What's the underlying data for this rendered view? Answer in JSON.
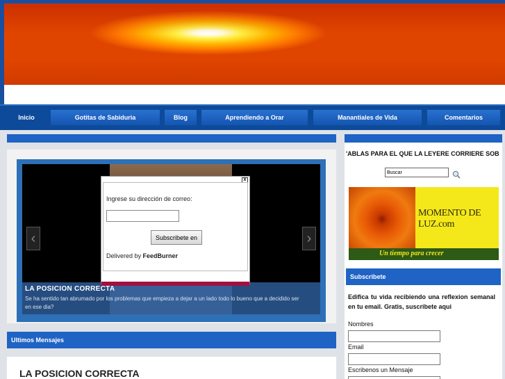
{
  "nav": {
    "items": [
      {
        "label": "Inicio"
      },
      {
        "label": "Gotitas de Sabiduria"
      },
      {
        "label": "Blog"
      },
      {
        "label": "Aprendiendo a Orar"
      },
      {
        "label": "Manantiales de Vida"
      },
      {
        "label": "Comentarios"
      }
    ]
  },
  "slider": {
    "title": "LA POSICION CORRECTA",
    "text": "Se ha sentido tan abrumado por los problemas que empieza a dejar a un lado todo lo bueno que a decidido ser en ese dia?",
    "prev_icon": "chevron-left-icon",
    "next_icon": "chevron-right-icon"
  },
  "popup": {
    "close": "x",
    "label": "Ingrese su dirección de correo:",
    "submit": "Subscribete en",
    "delivered_prefix": "Delivered by",
    "delivered_brand": "FeedBurner"
  },
  "main": {
    "ultimos": "Ultimos Mensajes",
    "post_title": "LA POSICION CORRECTA"
  },
  "sidebar": {
    "marquee": "'ABLAS PARA EL QUE LA LEYERE CORRIERE SOB",
    "search_value": "Buscar",
    "search_icon": "magnifier-icon",
    "ad": {
      "brand": "MOMENTO DE LUZ.com",
      "tagline": "Un tiempo para crecer"
    },
    "subscribe_title": "Subscribete",
    "subscribe_desc": "Edifica tu vida recibiendo una reflexion semanal en tu email. Gratis, suscribete aqui",
    "form": {
      "name_label": "Nombres",
      "email_label": "Email",
      "message_label": "Escribenos un Mensaje"
    }
  },
  "colors": {
    "nav_bg": "#0d4a99",
    "bar_blue": "#1f63c4",
    "popup_accent": "#a01040"
  }
}
